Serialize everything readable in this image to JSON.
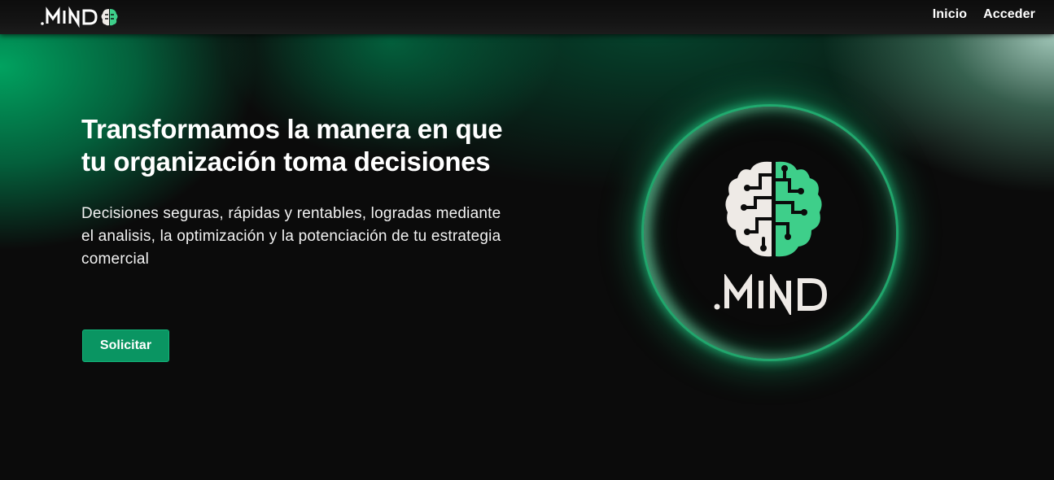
{
  "nav": {
    "brand": ".MIND",
    "links": [
      "Inicio",
      "Acceder"
    ]
  },
  "hero": {
    "title": "Transformamos la manera en que tu organización toma decisiones",
    "subtitle": "Decisiones seguras, rápidas y rentables, logradas mediante el analisis, la optimización y la potenciación de tu estrategia comercial",
    "cta": "Solicitar"
  },
  "logo": {
    "wordmark": ".MIND",
    "icon": "brain-circuit-icon"
  },
  "colors": {
    "accent": "#0a9562",
    "brain_left": "#eeeae6",
    "brain_right": "#3ecf8a",
    "background": "#0b0b0b"
  }
}
